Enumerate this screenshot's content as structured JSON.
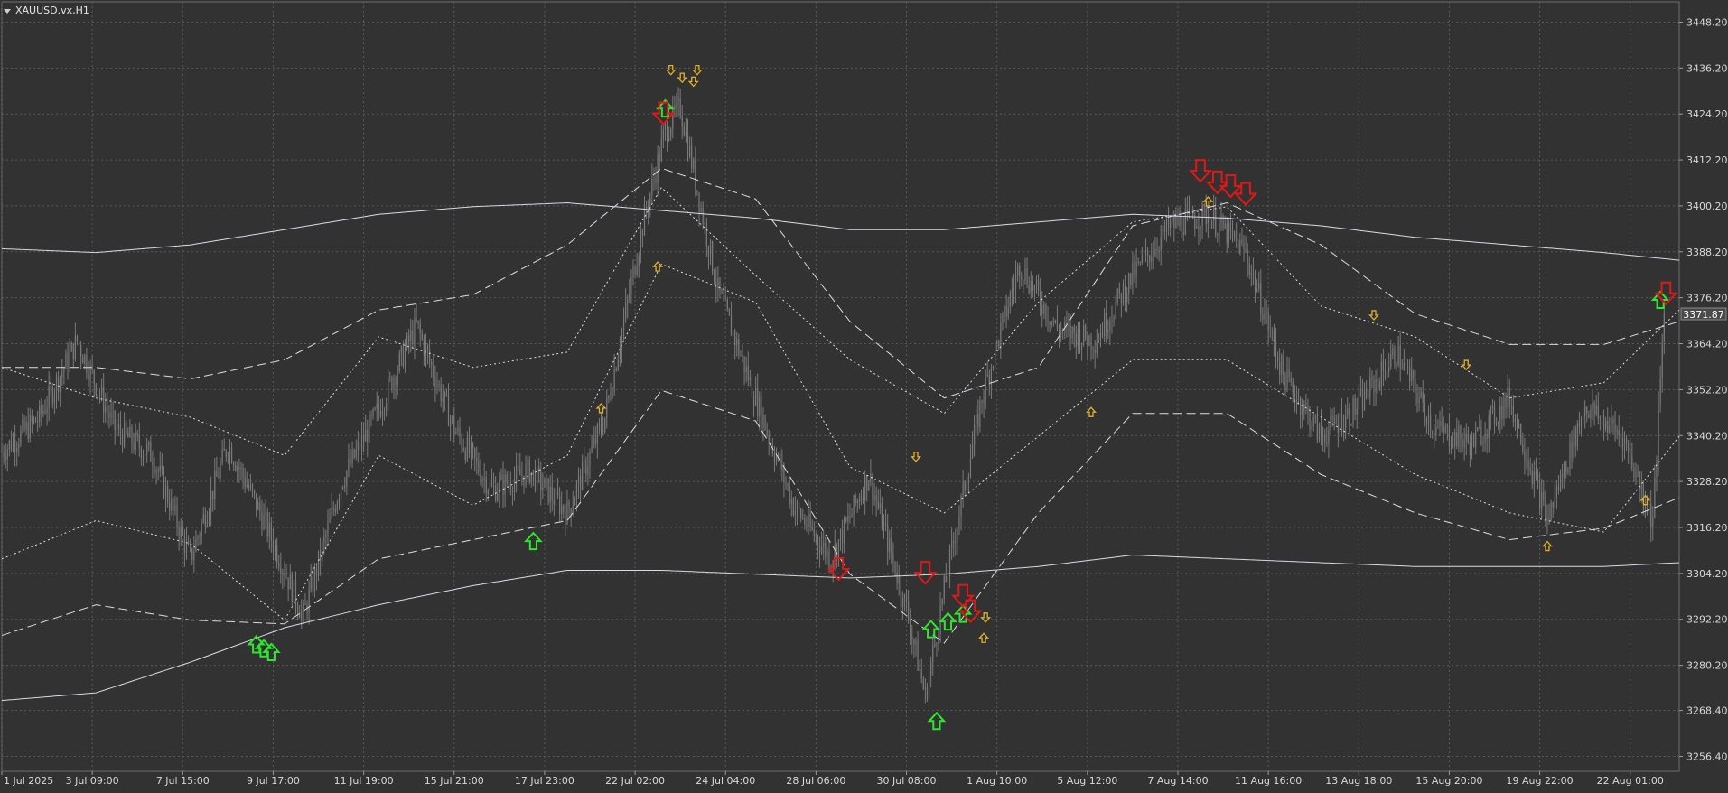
{
  "window": {
    "symbol_label": "XAUUSD.vx,H1"
  },
  "price": {
    "current": "3371.87",
    "current_value": 3371.87
  },
  "colors": {
    "background": "#323232",
    "grid": "#5a5a5a",
    "candles": "#7a7a7a",
    "bands": "#d8dce6",
    "buy_arrow": "#2ee62e",
    "sell_arrow": "#e01818",
    "small_arrow": "#e0b030"
  },
  "chart_data": {
    "type": "line",
    "yaxis": {
      "ticks": [
        3448.2,
        3436.2,
        3424.2,
        3412.2,
        3400.2,
        3388.2,
        3376.2,
        3364.2,
        3352.2,
        3340.2,
        3328.2,
        3316.2,
        3304.2,
        3292.2,
        3280.2,
        3268.4,
        3256.4
      ],
      "tick_labels": [
        "3448.20",
        "3436.20",
        "3424.20",
        "3412.20",
        "3400.20",
        "3388.20",
        "3376.20",
        "3364.20",
        "3352.20",
        "3340.20",
        "3328.20",
        "3316.20",
        "3304.20",
        "3292.20",
        "3280.20",
        "3268.40",
        "3256.40"
      ],
      "ylim": [
        3252.5,
        3453.5
      ]
    },
    "xaxis": {
      "tick_labels": [
        "1 Jul 2025",
        "3 Jul 09:00",
        "7 Jul 15:00",
        "9 Jul 17:00",
        "11 Jul 19:00",
        "15 Jul 21:00",
        "17 Jul 23:00",
        "22 Jul 02:00",
        "24 Jul 04:00",
        "28 Jul 06:00",
        "30 Jul 08:00",
        "1 Aug 10:00",
        "5 Aug 12:00",
        "7 Aug 14:00",
        "11 Aug 16:00",
        "13 Aug 18:00",
        "15 Aug 20:00",
        "19 Aug 22:00",
        "22 Aug 01:00"
      ],
      "tick_index": [
        0,
        48,
        96,
        144,
        192,
        240,
        288,
        336,
        384,
        432,
        480,
        528,
        576,
        624,
        672,
        720,
        768,
        816,
        864
      ],
      "xlim": [
        0,
        890
      ]
    },
    "close_series": {
      "index": [
        0,
        20,
        40,
        60,
        80,
        100,
        120,
        140,
        160,
        180,
        200,
        220,
        240,
        260,
        280,
        300,
        320,
        340,
        352,
        360,
        380,
        400,
        420,
        440,
        460,
        480,
        490,
        500,
        520,
        540,
        560,
        580,
        600,
        620,
        640,
        660,
        680,
        700,
        720,
        740,
        760,
        780,
        800,
        820,
        840,
        860,
        876,
        882
      ],
      "values": [
        3336,
        3345,
        3365,
        3342,
        3335,
        3308,
        3338,
        3317,
        3293,
        3328,
        3347,
        3369,
        3342,
        3326,
        3331,
        3320,
        3345,
        3395,
        3420,
        3426,
        3378,
        3350,
        3322,
        3308,
        3330,
        3295,
        3272,
        3300,
        3350,
        3385,
        3368,
        3365,
        3382,
        3395,
        3398,
        3388,
        3356,
        3340,
        3348,
        3362,
        3342,
        3338,
        3350,
        3318,
        3348,
        3340,
        3318,
        3372
      ]
    },
    "band_outer_upper": {
      "index": [
        0,
        50,
        100,
        150,
        200,
        250,
        300,
        350,
        400,
        450,
        500,
        550,
        600,
        650,
        700,
        750,
        800,
        850,
        890
      ],
      "values": [
        3389,
        3388,
        3390,
        3394,
        3398,
        3400,
        3401,
        3399,
        3397,
        3394,
        3394,
        3396,
        3398,
        3397,
        3395,
        3392,
        3390,
        3388,
        3386
      ]
    },
    "band_outer_lower": {
      "index": [
        0,
        50,
        100,
        150,
        200,
        250,
        300,
        350,
        400,
        450,
        500,
        550,
        600,
        650,
        700,
        750,
        800,
        850,
        890
      ],
      "values": [
        3271,
        3273,
        3281,
        3290,
        3296,
        3301,
        3305,
        3305,
        3304,
        3303,
        3304,
        3306,
        3309,
        3308,
        3307,
        3306,
        3306,
        3306,
        3307
      ]
    },
    "band_mid_dash": {
      "index": [
        0,
        50,
        100,
        150,
        200,
        250,
        300,
        350,
        400,
        450,
        500,
        550,
        600,
        650,
        700,
        750,
        800,
        850,
        890
      ],
      "values": [
        3358,
        3358,
        3355,
        3360,
        3373,
        3377,
        3390,
        3410,
        3402,
        3370,
        3350,
        3358,
        3395,
        3401,
        3390,
        3372,
        3364,
        3364,
        3370
      ]
    },
    "band_lower_dash": {
      "index": [
        0,
        50,
        100,
        150,
        200,
        250,
        300,
        350,
        400,
        450,
        500,
        550,
        600,
        650,
        700,
        750,
        800,
        850,
        890
      ],
      "values": [
        3288,
        3296,
        3292,
        3291,
        3308,
        3313,
        3318,
        3352,
        3344,
        3304,
        3286,
        3320,
        3346,
        3346,
        3330,
        3320,
        3313,
        3316,
        3324
      ]
    },
    "envelope_upper_dot": {
      "index": [
        0,
        50,
        100,
        150,
        200,
        250,
        300,
        350,
        400,
        450,
        500,
        550,
        600,
        650,
        700,
        750,
        800,
        850,
        890
      ],
      "values": [
        3358,
        3350,
        3345,
        3335,
        3366,
        3358,
        3362,
        3405,
        3382,
        3360,
        3346,
        3375,
        3396,
        3400,
        3374,
        3366,
        3350,
        3354,
        3373
      ]
    },
    "envelope_lower_dot": {
      "index": [
        0,
        50,
        100,
        150,
        200,
        250,
        300,
        350,
        400,
        450,
        500,
        550,
        600,
        650,
        700,
        750,
        800,
        850,
        890
      ],
      "values": [
        3308,
        3318,
        3312,
        3292,
        3335,
        3322,
        3335,
        3385,
        3375,
        3332,
        3320,
        3340,
        3360,
        3360,
        3345,
        3330,
        3320,
        3315,
        3340
      ]
    },
    "signals": {
      "buy_large": [
        {
          "index": 135,
          "value": 3288
        },
        {
          "index": 139,
          "value": 3287
        },
        {
          "index": 143,
          "value": 3286
        },
        {
          "index": 282,
          "value": 3315
        },
        {
          "index": 352,
          "value": 3428
        },
        {
          "index": 493,
          "value": 3292
        },
        {
          "index": 496,
          "value": 3268
        },
        {
          "index": 502,
          "value": 3294
        },
        {
          "index": 510,
          "value": 3296
        },
        {
          "index": 880,
          "value": 3378
        }
      ],
      "sell_large": [
        {
          "index": 351,
          "value": 3422
        },
        {
          "index": 444,
          "value": 3303
        },
        {
          "index": 490,
          "value": 3302
        },
        {
          "index": 510,
          "value": 3296
        },
        {
          "index": 514,
          "value": 3292
        },
        {
          "index": 636,
          "value": 3407
        },
        {
          "index": 645,
          "value": 3404
        },
        {
          "index": 652,
          "value": 3403
        },
        {
          "index": 660,
          "value": 3401
        },
        {
          "index": 883,
          "value": 3375
        }
      ],
      "small_up": [
        {
          "index": 348,
          "value": 3386
        },
        {
          "index": 318,
          "value": 3349
        },
        {
          "index": 578,
          "value": 3348
        },
        {
          "index": 521,
          "value": 3289
        },
        {
          "index": 820,
          "value": 3313
        },
        {
          "index": 872,
          "value": 3325
        },
        {
          "index": 640,
          "value": 3403
        }
      ],
      "small_down": [
        {
          "index": 355,
          "value": 3434
        },
        {
          "index": 361,
          "value": 3432
        },
        {
          "index": 367,
          "value": 3431
        },
        {
          "index": 369,
          "value": 3434
        },
        {
          "index": 485,
          "value": 3333
        },
        {
          "index": 522,
          "value": 3291
        },
        {
          "index": 728,
          "value": 3370
        },
        {
          "index": 777,
          "value": 3357
        }
      ]
    }
  }
}
